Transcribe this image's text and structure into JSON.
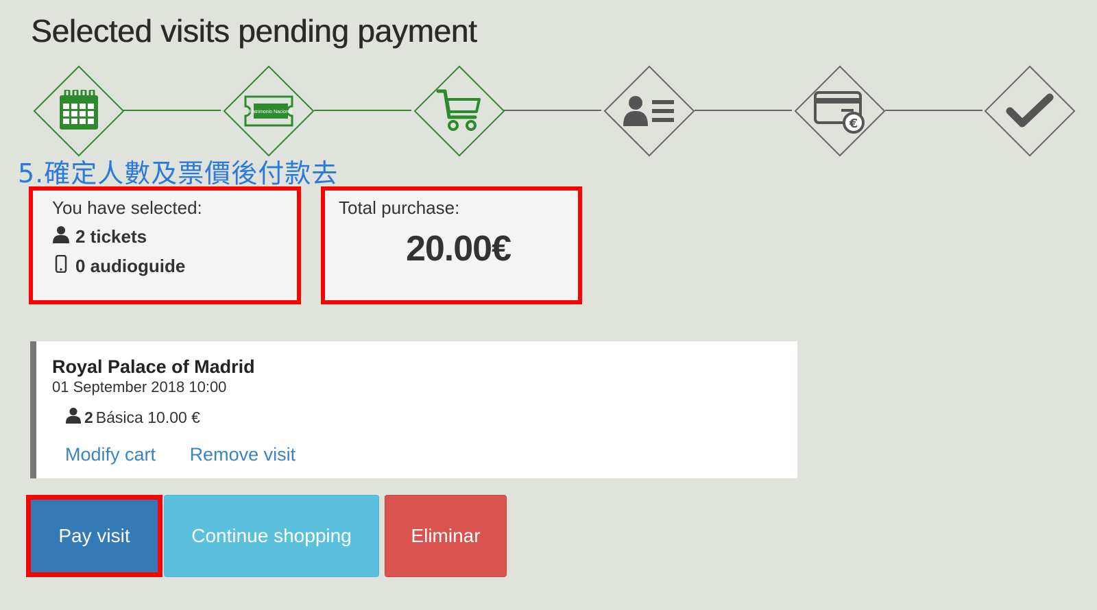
{
  "page": {
    "title": "Selected visits pending payment"
  },
  "steps": [
    {
      "name": "calendar",
      "status": "done"
    },
    {
      "name": "ticket",
      "status": "done",
      "ticket_text": "Patrimonio Nacional"
    },
    {
      "name": "cart",
      "status": "current"
    },
    {
      "name": "user-data",
      "status": "pending"
    },
    {
      "name": "payment",
      "status": "pending"
    },
    {
      "name": "confirmation",
      "status": "pending"
    }
  ],
  "annotation": "5.確定人數及票價後付款去",
  "selection": {
    "label": "You have selected:",
    "tickets": "2 tickets",
    "audioguide": "0 audioguide"
  },
  "total": {
    "label": "Total purchase:",
    "amount": "20.00€"
  },
  "visit": {
    "name": "Royal Palace of Madrid",
    "datetime": "01 September 2018 10:00",
    "ticket_qty": "2",
    "ticket_desc": "Básica 10.00 €",
    "modify_label": "Modify cart",
    "remove_label": "Remove visit"
  },
  "buttons": {
    "pay": "Pay visit",
    "continue": "Continue shopping",
    "delete": "Eliminar"
  },
  "colors": {
    "done": "#2d8a2d",
    "pending": "#666666",
    "highlight": "#ff0000",
    "annotation": "#2b7ad9",
    "link": "#3a84c6",
    "pay": "#337ab7",
    "continue": "#5bc0de",
    "delete": "#d9534f"
  }
}
